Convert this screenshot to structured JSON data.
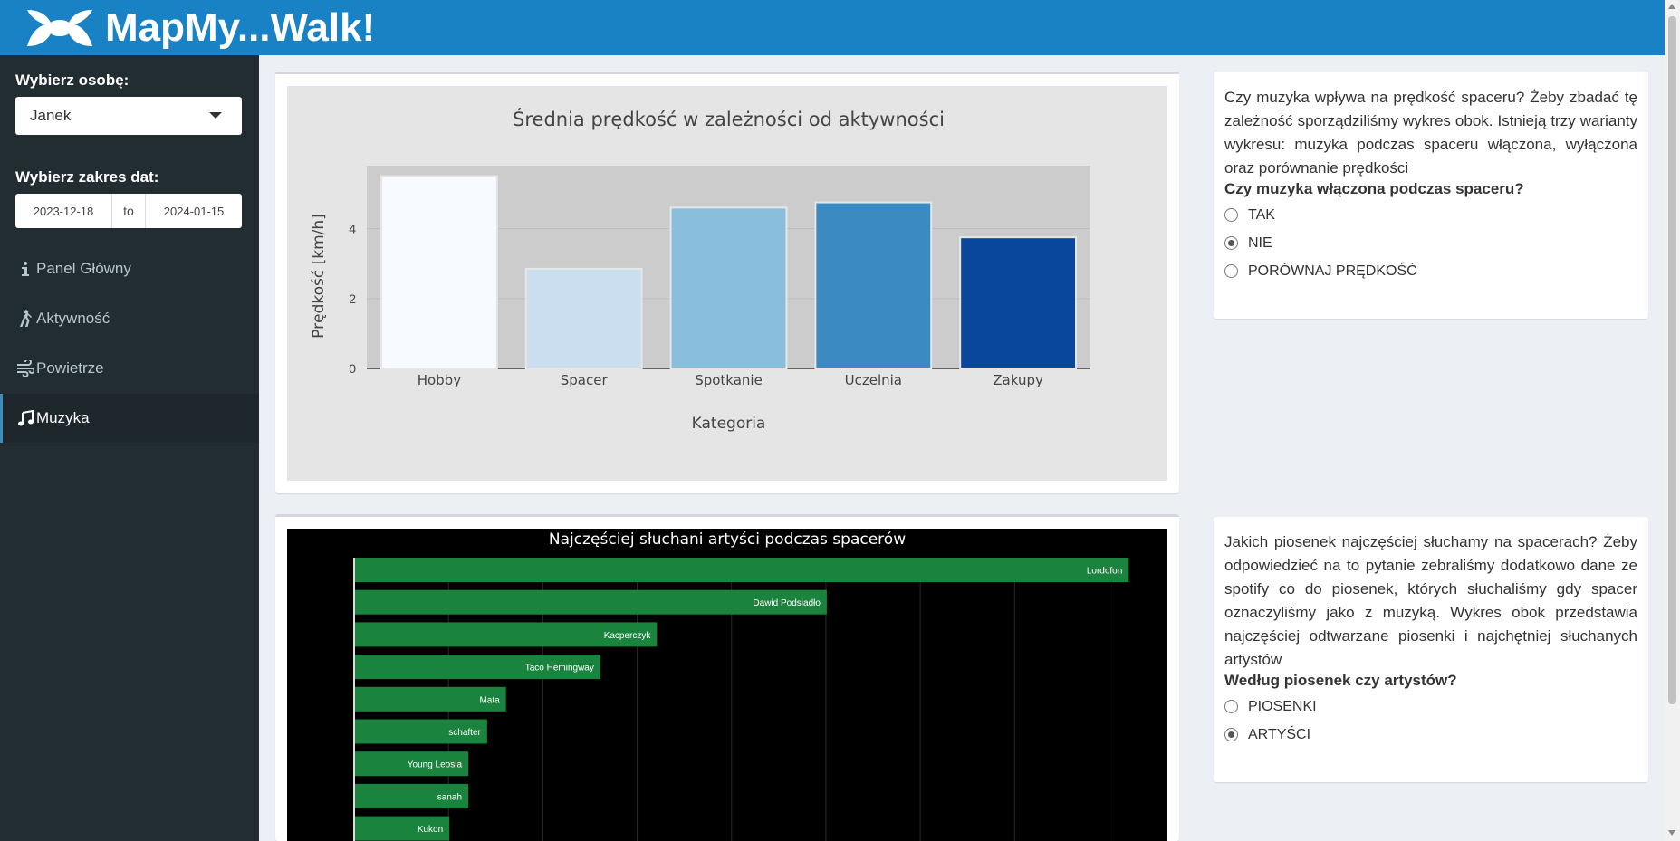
{
  "app": {
    "title": "MapMy...Walk!"
  },
  "sidebar": {
    "person_label": "Wybierz osobę:",
    "person_value": "Janek",
    "date_label": "Wybierz zakres dat:",
    "date_from": "2023-12-18",
    "date_sep": "to",
    "date_to": "2024-01-15",
    "items": [
      {
        "label": "Panel Główny",
        "icon": "info-icon"
      },
      {
        "label": "Aktywność",
        "icon": "walking-icon"
      },
      {
        "label": "Powietrze",
        "icon": "wind-icon"
      },
      {
        "label": "Muzyka",
        "icon": "music-icon",
        "active": true
      }
    ]
  },
  "panel1": {
    "text": "Czy muzyka wpływa na prędkość spaceru? Żeby zbadać tę zależność sporządziliśmy wykres obok. Istnieją trzy warianty wykresu: muzyka podczas spaceru włączona, wyłączona oraz porównanie prędkości",
    "question": "Czy muzyka włączona podczas spaceru?",
    "options": [
      "TAK",
      "NIE",
      "PORÓWNAJ PRĘDKOŚĆ"
    ],
    "selected": 1
  },
  "panel2": {
    "text": "Jakich piosenek najczęściej słuchamy na spacerach? Żeby odpowiedzieć na to pytanie zebraliśmy dodatkowo dane ze spotify co do piosenek, których słuchaliśmy gdy spacer oznaczyliśmy jako z muzyką. Wykres obok przedstawia najczęściej odtwarzane piosenki i najchętniej słuchanych artystów",
    "question": "Według piosenek czy artystów?",
    "options": [
      "PIOSENKI",
      "ARTYŚCI"
    ],
    "selected": 1
  },
  "chart_data": [
    {
      "type": "bar",
      "title": "Średnia prędkość w zależności od aktywności",
      "xlabel": "Kategoria",
      "ylabel": "Prędkość [km/h]",
      "categories": [
        "Hobby",
        "Spacer",
        "Spotkanie",
        "Uczelnia",
        "Zakupy"
      ],
      "values": [
        5.5,
        2.85,
        4.6,
        4.75,
        3.75
      ],
      "colors": [
        "#f7fbff",
        "#cbdef0",
        "#88bedc",
        "#3b8bc2",
        "#08479b"
      ],
      "ylim": [
        0,
        5.8
      ],
      "yticks": [
        0,
        2,
        4
      ],
      "grid": true
    },
    {
      "type": "bar",
      "orientation": "horizontal",
      "title": "Najczęściej słuchani artyści podczas spacerów",
      "categories": [
        "Lordofon",
        "Dawid Podsiadło",
        "Kacperczyk",
        "Taco Hemingway",
        "Mata",
        "schafter",
        "Young Leosia",
        "sanah",
        "Kukon"
      ],
      "values": [
        82,
        50,
        32,
        26,
        16,
        14,
        12,
        12,
        10
      ],
      "xlim": [
        0,
        86
      ],
      "bar_color": "#1a843e",
      "background": "#000000",
      "grid": true
    }
  ]
}
